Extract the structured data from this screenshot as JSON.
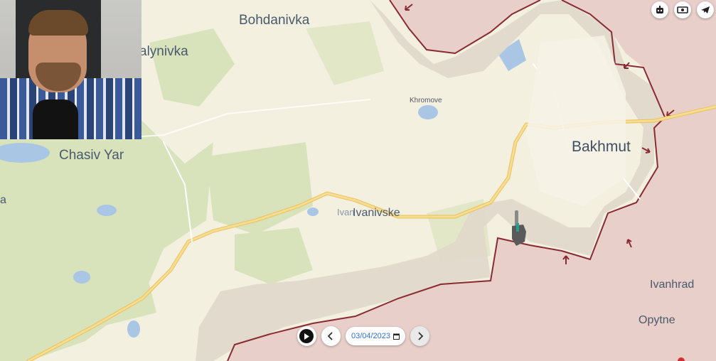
{
  "map": {
    "places": [
      {
        "id": "bohdanivka",
        "label": "Bohdanivka"
      },
      {
        "id": "kalynivka",
        "label": "alynivka"
      },
      {
        "id": "chasiv-yar",
        "label": "Chasiv Yar"
      },
      {
        "id": "khromove",
        "label": "Khromove"
      },
      {
        "id": "bakhmut",
        "label": "Bakhmut"
      },
      {
        "id": "ivanivske-faded",
        "label": "Ivan"
      },
      {
        "id": "ivanivske",
        "label": "Ivanivske"
      },
      {
        "id": "ivanhrad",
        "label": "Ivanhrad"
      },
      {
        "id": "opytne",
        "label": "Opytne"
      },
      {
        "id": "edge-a",
        "label": "a"
      }
    ],
    "colors": {
      "friendly": "#f3f0e0",
      "green": "#d7e3bc",
      "occupied": "#e8cfc9",
      "contested": "#e2dcd0",
      "front_line": "#8a2b33",
      "road": "#f1c96a",
      "water": "#a9c6e4"
    }
  },
  "toolbar": {
    "icons": [
      "robot-icon",
      "money-icon",
      "telegram-icon"
    ]
  },
  "timeline": {
    "date": "03/04/2023",
    "play_icon": "play-icon",
    "prev_icon": "chevron-left-icon",
    "next_icon": "chevron-right-icon",
    "calendar_icon": "calendar-icon"
  },
  "webcam": {
    "description_icon": "presenter-video"
  }
}
